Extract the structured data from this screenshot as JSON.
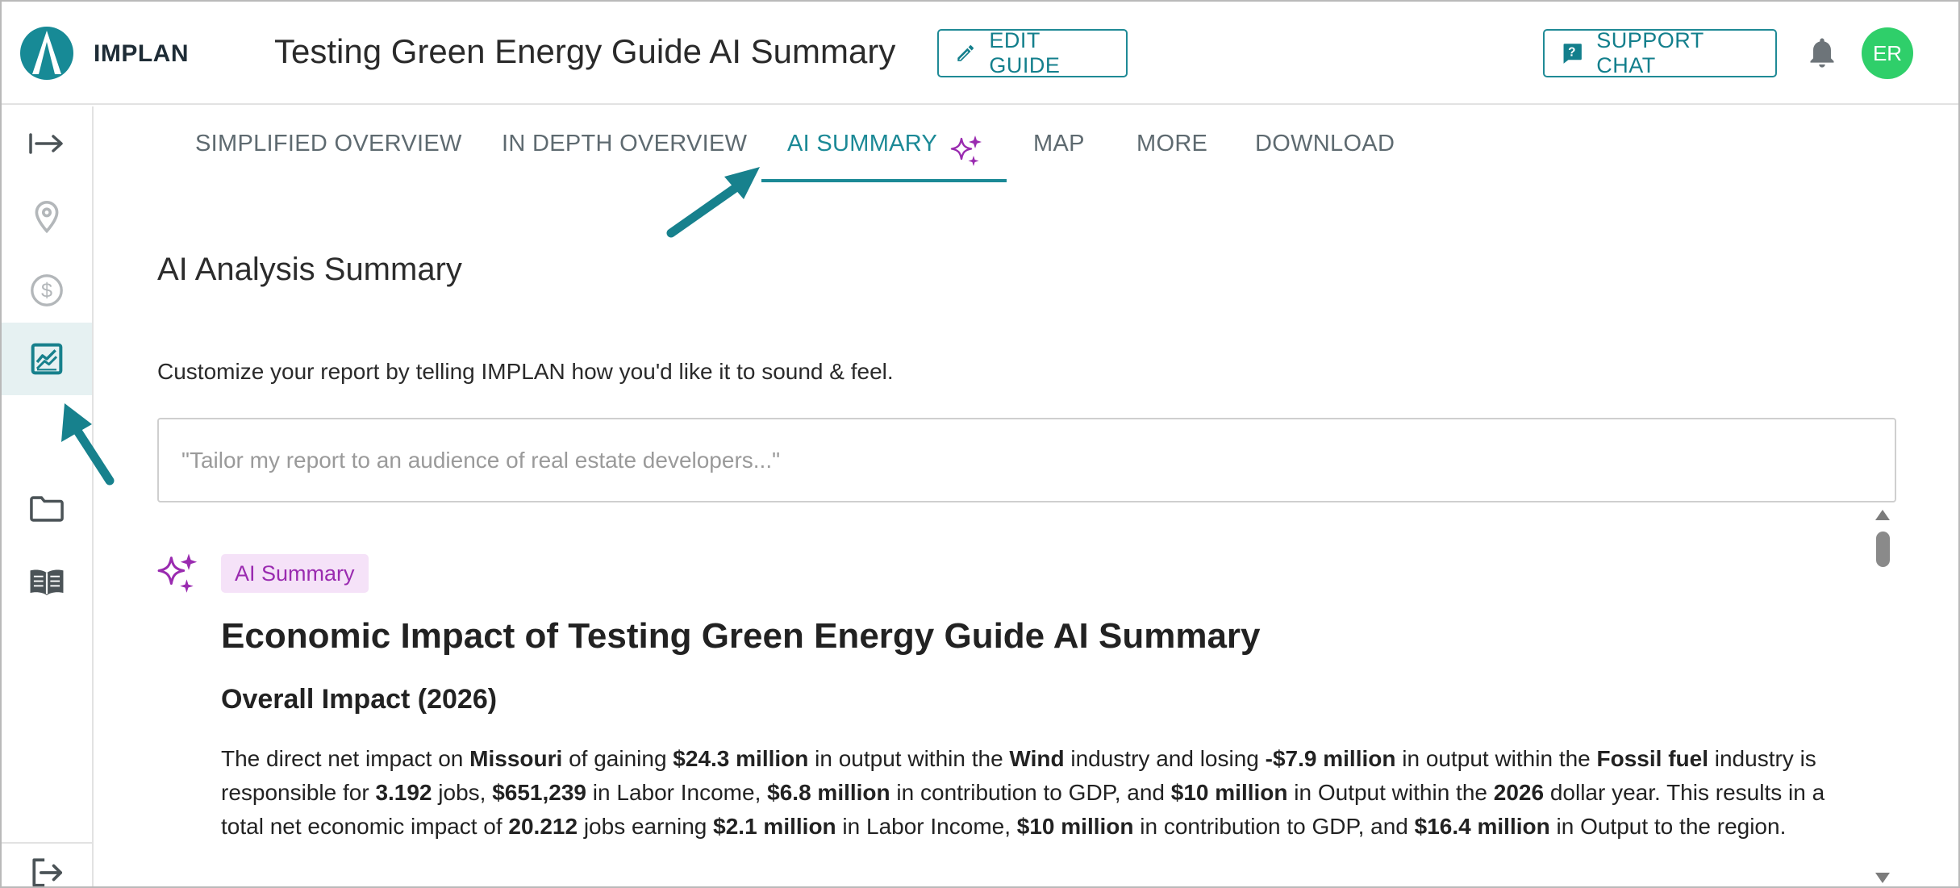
{
  "header": {
    "brand": "IMPLAN",
    "title": "Testing Green Energy Guide AI Summary",
    "edit_guide_label": "EDIT GUIDE",
    "support_chat_label": "SUPPORT CHAT",
    "avatar_initials": "ER",
    "colors": {
      "accent": "#1b8996",
      "avatar": "#2fcf6a",
      "logo": "#178a96"
    }
  },
  "sidebar": {
    "items": [
      {
        "icon": "expand-arrow-icon"
      },
      {
        "icon": "location-pin-icon"
      },
      {
        "icon": "dollar-circle-icon"
      },
      {
        "icon": "analytics-chart-icon",
        "active": true
      },
      {
        "icon": "folder-icon"
      },
      {
        "icon": "book-icon"
      },
      {
        "icon": "logout-icon"
      }
    ]
  },
  "tabs": [
    {
      "label": "SIMPLIFIED OVERVIEW"
    },
    {
      "label": "IN DEPTH OVERVIEW"
    },
    {
      "label": "AI SUMMARY",
      "active": true
    },
    {
      "label": "MAP"
    },
    {
      "label": "MORE"
    },
    {
      "label": "DOWNLOAD"
    }
  ],
  "main": {
    "section_title": "AI Analysis Summary",
    "customize_text": "Customize your report by telling IMPLAN how you'd like it to sound & feel.",
    "prompt_placeholder": "\"Tailor my report to an audience of real estate developers...\"",
    "badge": "AI Summary",
    "summary_heading": "Economic Impact of Testing Green Energy Guide AI Summary",
    "overall_heading": "Overall Impact (2026)",
    "paragraph": [
      {
        "t": "The direct net impact on "
      },
      {
        "t": "Missouri",
        "b": true
      },
      {
        "t": " of gaining "
      },
      {
        "t": "$24.3 million",
        "b": true
      },
      {
        "t": " in output within the "
      },
      {
        "t": "Wind",
        "b": true
      },
      {
        "t": " industry and losing "
      },
      {
        "t": "-$7.9 million",
        "b": true
      },
      {
        "t": " in output within the "
      },
      {
        "t": "Fossil fuel",
        "b": true
      },
      {
        "t": " industry is responsible for "
      },
      {
        "t": "3.192",
        "b": true
      },
      {
        "t": " jobs, "
      },
      {
        "t": "$651,239",
        "b": true
      },
      {
        "t": " in Labor Income, "
      },
      {
        "t": "$6.8 million",
        "b": true
      },
      {
        "t": " in contribution to GDP, and "
      },
      {
        "t": "$10 million",
        "b": true
      },
      {
        "t": " in Output within the "
      },
      {
        "t": "2026",
        "b": true
      },
      {
        "t": " dollar year. This results in a total net economic impact of "
      },
      {
        "t": "20.212",
        "b": true
      },
      {
        "t": " jobs earning "
      },
      {
        "t": "$2.1 million",
        "b": true
      },
      {
        "t": " in Labor Income, "
      },
      {
        "t": "$10 million",
        "b": true
      },
      {
        "t": " in contribution to GDP, and "
      },
      {
        "t": "$16.4 million",
        "b": true
      },
      {
        "t": " in Output to the region."
      }
    ]
  }
}
